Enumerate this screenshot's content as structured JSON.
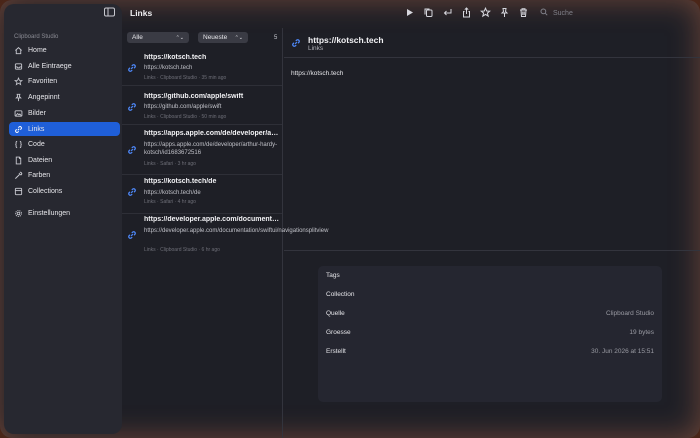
{
  "window": {
    "title": "Links"
  },
  "search": {
    "placeholder": "Suche"
  },
  "sidebar": {
    "section": "Clipboard Studio",
    "items": [
      {
        "label": "Home",
        "icon": "house-icon"
      },
      {
        "label": "Alle Eintraege",
        "icon": "tray-icon"
      },
      {
        "label": "Favoriten",
        "icon": "star-icon"
      },
      {
        "label": "Angepinnt",
        "icon": "pin-icon"
      },
      {
        "label": "Bilder",
        "icon": "photo-icon"
      },
      {
        "label": "Links",
        "icon": "link-icon",
        "active": true
      },
      {
        "label": "Code",
        "icon": "braces-icon"
      },
      {
        "label": "Dateien",
        "icon": "doc-icon"
      },
      {
        "label": "Farben",
        "icon": "eyedropper-icon"
      },
      {
        "label": "Collections",
        "icon": "folder-icon"
      },
      {
        "label": "Einstellungen",
        "icon": "gear-icon"
      }
    ]
  },
  "filters": {
    "type": "Alle",
    "sort": "Neueste",
    "count": "5"
  },
  "list": [
    {
      "title": "https://kotsch.tech",
      "sub": "https://kotsch.tech",
      "meta": "Links · Clipboard Studio · 35 min ago"
    },
    {
      "title": "https://github.com/apple/swift",
      "sub": "https://github.com/apple/swift",
      "meta": "Links · Clipboard Studio · 50 min ago"
    },
    {
      "title": "https://apps.apple.com/de/developer/art...",
      "sub": "https://apps.apple.com/de/developer/arthur-hardy-kotsch/id1683672516",
      "meta": "Links · Safari · 3 hr ago"
    },
    {
      "title": "https://kotsch.tech/de",
      "sub": "https://kotsch.tech/de",
      "meta": "Links · Safari · 4 hr ago"
    },
    {
      "title": "https://developer.apple.com/documentatio...",
      "sub": "https://developer.apple.com/documentation/swiftui/navigationsplitview",
      "meta": "Links · Clipboard Studio · 6 hr ago"
    }
  ],
  "detail": {
    "title": "https://kotsch.tech",
    "subtitle": "Links",
    "content": "https://kotsch.tech",
    "properties": [
      {
        "key": "Tags",
        "value": ""
      },
      {
        "key": "Collection",
        "value": ""
      },
      {
        "key": "Quelle",
        "value": "Clipboard Studio"
      },
      {
        "key": "Groesse",
        "value": "19 bytes"
      },
      {
        "key": "Erstellt",
        "value": "30. Jun 2026 at 15:51"
      }
    ]
  },
  "colors": {
    "accent": "#1f5fd8",
    "link": "#4f8bff"
  }
}
